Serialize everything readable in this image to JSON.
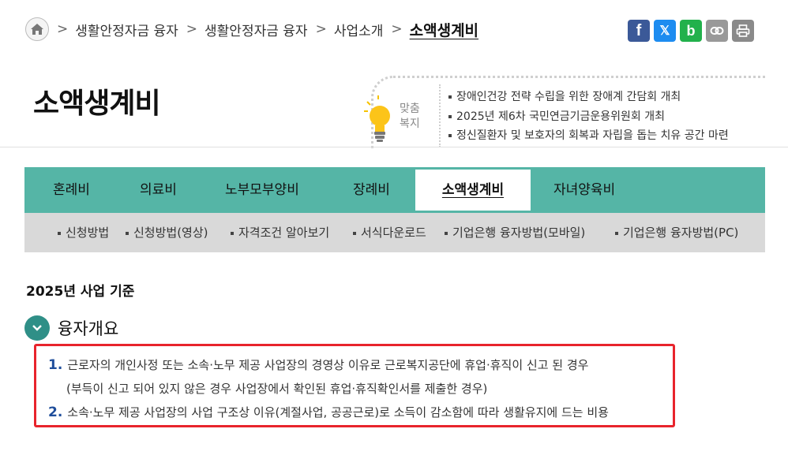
{
  "breadcrumb": {
    "items": [
      "생활안정자금 융자",
      "생활안정자금 융자",
      "사업소개"
    ],
    "current": "소액생계비"
  },
  "share": {
    "facebook_glyph": "f",
    "x_glyph": "𝕏",
    "band_glyph": "b"
  },
  "page": {
    "title": "소액생계비"
  },
  "news": {
    "label_line1": "맞춤",
    "label_line2": "복지",
    "items": [
      "장애인건강 전략 수립을 위한 장애계 간담회 개최",
      "2025년 제6차 국민연금기금운용위원회 개최",
      "정신질환자 및 보호자의 회복과 자립을 돕는 치유 공간 마련"
    ]
  },
  "tabs": [
    "혼례비",
    "의료비",
    "노부모부양비",
    "장례비",
    "소액생계비",
    "자녀양육비"
  ],
  "submenu": [
    "신청방법",
    "신청방법(영상)",
    "자격조건 알아보기",
    "서식다운로드",
    "기업은행 융자방법(모바일)",
    "기업은행 융자방법(PC)"
  ],
  "content": {
    "year_basis": "2025년 사업 기준",
    "section_title": "융자개요",
    "items": [
      {
        "num": "1.",
        "text": "근로자의 개인사정 또는 소속·노무 제공 사업장의 경영상 이유로 근로복지공단에 휴업·휴직이 신고 된 경우"
      },
      {
        "text": "(부득이 신고 되어 있지 않은 경우 사업장에서 확인된 휴업·휴직확인서를 제출한 경우)"
      },
      {
        "num": "2.",
        "text": "소속·노무 제공 사업장의 사업 구조상 이유(계절사업, 공공근로)로 소득이 감소함에 따라 생활유지에 드는 비용"
      }
    ]
  },
  "colors": {
    "tab_bg": "#55b5a6",
    "submenu_bg": "#d9d9d9",
    "accent_teal": "#2f8f87",
    "highlight_red": "#e8242c",
    "number_blue": "#1f4e9b"
  }
}
